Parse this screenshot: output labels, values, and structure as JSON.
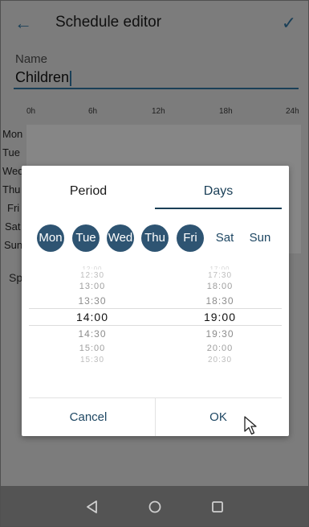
{
  "app": {
    "title": "Schedule editor",
    "name_label": "Name",
    "name_value": "Children"
  },
  "timeline": {
    "hours": [
      "0h",
      "6h",
      "12h",
      "18h",
      "24h"
    ],
    "days": [
      "Mon",
      "Tue",
      "Wed",
      "Thu",
      "Fri",
      "Sat",
      "Sun"
    ],
    "partial_label": "Sp"
  },
  "dialog": {
    "tabs": [
      {
        "label": "Period",
        "selected": false
      },
      {
        "label": "Days",
        "selected": true
      }
    ],
    "days": [
      {
        "label": "Mon",
        "selected": true
      },
      {
        "label": "Tue",
        "selected": true
      },
      {
        "label": "Wed",
        "selected": true
      },
      {
        "label": "Thu",
        "selected": true
      },
      {
        "label": "Fri",
        "selected": true
      },
      {
        "label": "Sat",
        "selected": false
      },
      {
        "label": "Sun",
        "selected": false
      }
    ],
    "start_picker": {
      "values": [
        "12:30",
        "13:00",
        "13:30",
        "14:00",
        "14:30",
        "15:00",
        "15:30"
      ],
      "selected": "14:00"
    },
    "end_picker": {
      "values": [
        "17:30",
        "18:00",
        "18:30",
        "19:00",
        "19:30",
        "20:00",
        "20:30"
      ],
      "selected": "19:00"
    },
    "cancel_label": "Cancel",
    "ok_label": "OK"
  },
  "colors": {
    "accent": "#1a3f57",
    "day_selected": "#2e5472",
    "scrim": "#7c7c7c"
  }
}
